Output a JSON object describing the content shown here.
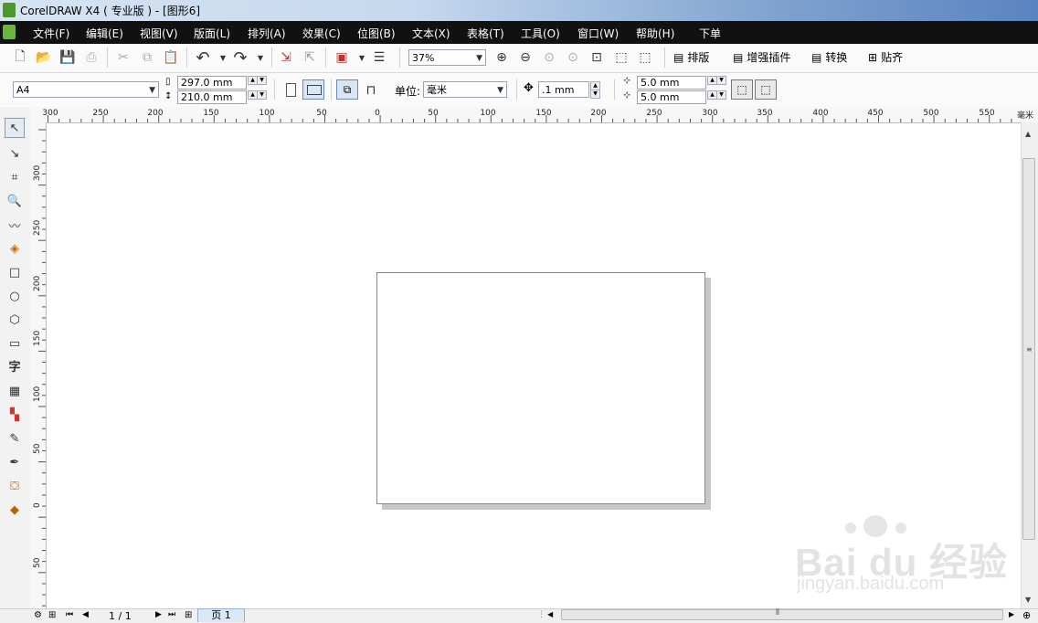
{
  "window": {
    "title": "CorelDRAW X4 ( 专业版 ) - [图形6]"
  },
  "menu": [
    "文件(F)",
    "编辑(E)",
    "视图(V)",
    "版面(L)",
    "排列(A)",
    "效果(C)",
    "位图(B)",
    "文本(X)",
    "表格(T)",
    "工具(O)",
    "窗口(W)",
    "帮助(H)",
    "下单"
  ],
  "toolbar": {
    "zoom_value": "37%",
    "layout_label": "排版",
    "plugins_label": "增强插件",
    "convert_label": "转换",
    "snap_label": "贴齐"
  },
  "propertybar": {
    "paper_size": "A4",
    "width": "297.0 mm",
    "height": "210.0 mm",
    "unit_label": "单位:",
    "unit_value": "毫米",
    "nudge": ".1 mm",
    "dup_x": "5.0 mm",
    "dup_y": "5.0 mm"
  },
  "ruler": {
    "unit": "毫米",
    "h_ticks": [
      "300",
      "250",
      "200",
      "150",
      "100",
      "50",
      "0",
      "50",
      "100",
      "150",
      "200",
      "250",
      "300",
      "350",
      "400",
      "450",
      "500",
      "550"
    ],
    "v_ticks": [
      "300",
      "250",
      "200",
      "150",
      "100",
      "50",
      "0",
      "50"
    ]
  },
  "statusbar": {
    "page_count": "1 / 1",
    "page_tab": "页 1"
  },
  "watermark": {
    "brand": "Bai du 经验",
    "url": "jingyan.baidu.com"
  }
}
